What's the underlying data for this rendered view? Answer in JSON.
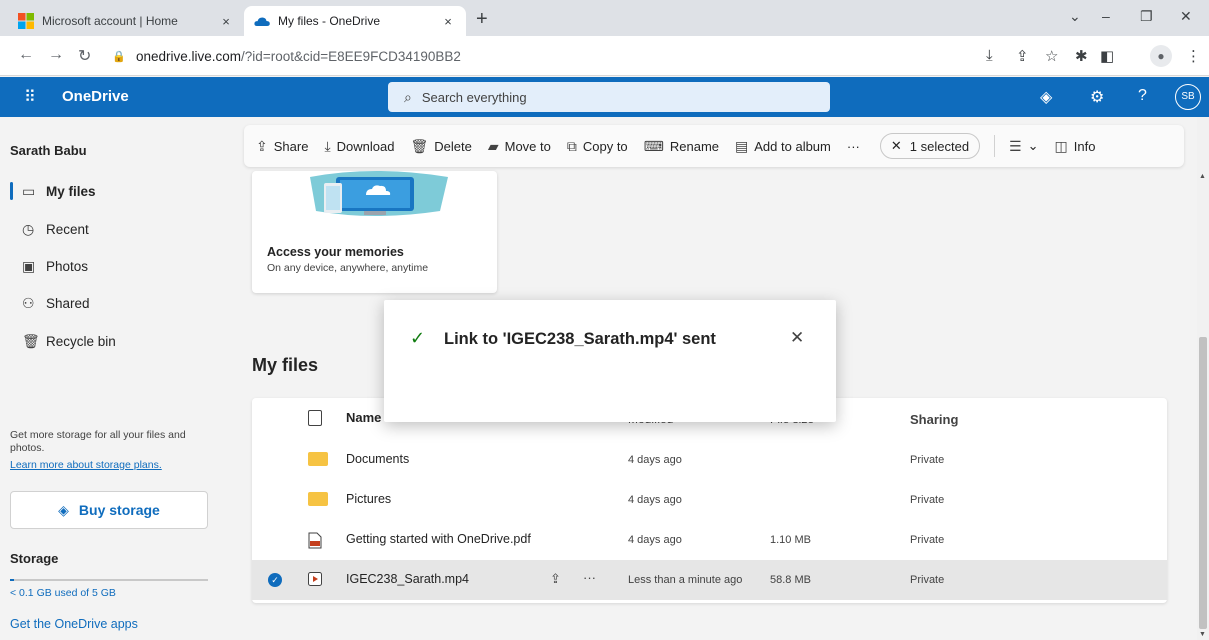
{
  "browser": {
    "tabs": [
      {
        "title": "Microsoft account | Home",
        "close": "×"
      },
      {
        "title": "My files - OneDrive",
        "close": "×"
      }
    ],
    "new_tab": "+",
    "window_controls": {
      "chevron": "⌄",
      "minimize": "–",
      "restore": "❐",
      "close": "✕"
    },
    "url_host": "onedrive.live.com",
    "url_path": "/?id=root&cid=E8EE9FCD34190BB2"
  },
  "header": {
    "app_name": "OneDrive",
    "search_placeholder": "Search everything",
    "avatar_initials": "SB"
  },
  "sidebar": {
    "user_name": "Sarath Babu",
    "items": [
      {
        "label": "My files",
        "icon": "folder-icon"
      },
      {
        "label": "Recent",
        "icon": "clock-icon"
      },
      {
        "label": "Photos",
        "icon": "photo-icon"
      },
      {
        "label": "Shared",
        "icon": "people-icon"
      },
      {
        "label": "Recycle bin",
        "icon": "trash-icon"
      }
    ],
    "storage_note": "Get more storage for all your files and photos.",
    "storage_link": "Learn more about storage plans.",
    "buy_storage": "Buy storage",
    "storage_heading": "Storage",
    "storage_used": "< 0.1 GB used of 5 GB",
    "storage_fraction": 0.02,
    "get_apps": "Get the OneDrive apps"
  },
  "commands": {
    "share": "Share",
    "download": "Download",
    "delete": "Delete",
    "move_to": "Move to",
    "copy_to": "Copy to",
    "rename": "Rename",
    "add_to_album": "Add to album",
    "more": "···",
    "selected": "1 selected",
    "info": "Info"
  },
  "memories": {
    "title": "Access your memories",
    "subtitle": "On any device, anywhere, anytime"
  },
  "files": {
    "heading": "My files",
    "columns": {
      "name": "Name",
      "modified": "Modified",
      "size": "File size",
      "sharing": "Sharing"
    },
    "rows": [
      {
        "name": "Documents",
        "modified": "4 days ago",
        "size": "",
        "sharing": "Private",
        "type": "folder"
      },
      {
        "name": "Pictures",
        "modified": "4 days ago",
        "size": "",
        "sharing": "Private",
        "type": "folder"
      },
      {
        "name": "Getting started with OneDrive.pdf",
        "modified": "4 days ago",
        "size": "1.10 MB",
        "sharing": "Private",
        "type": "pdf"
      },
      {
        "name": "IGEC238_Sarath.mp4",
        "modified": "Less than a minute ago",
        "size": "58.8 MB",
        "sharing": "Private",
        "type": "video",
        "selected": true
      }
    ]
  },
  "toast": {
    "message": "Link to 'IGEC238_Sarath.mp4' sent"
  },
  "colors": {
    "brand": "#0f6cbd",
    "success": "#107c10",
    "folder": "#f6c343",
    "pdf": "#c43e1c"
  }
}
